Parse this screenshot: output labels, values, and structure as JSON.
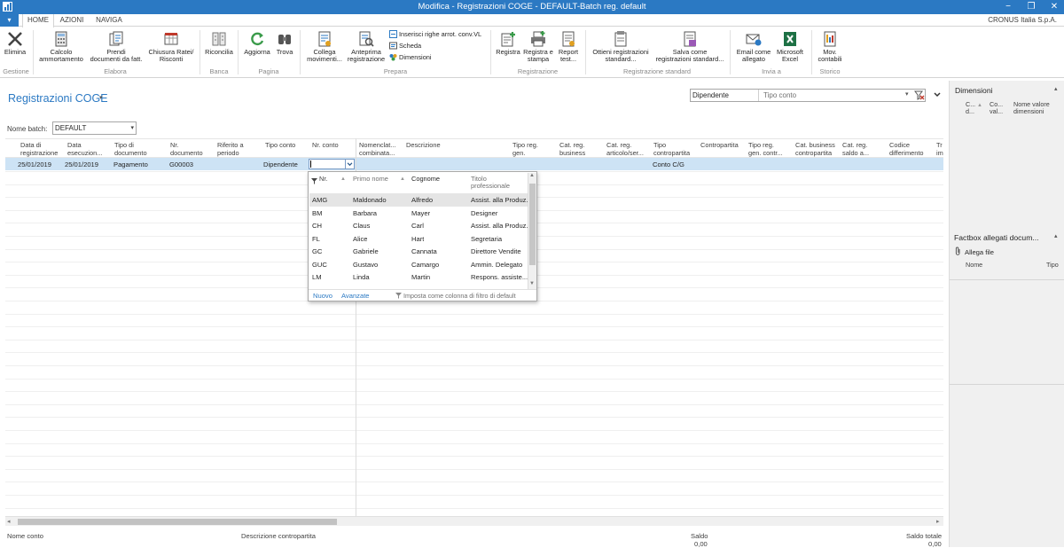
{
  "window": {
    "title": "Modifica - Registrazioni COGE - DEFAULT-Batch reg. default",
    "minimize": "−",
    "restore": "❐",
    "close": "✕",
    "colors": {
      "titlebar": "#2b79c3",
      "selection": "#cde3f5",
      "link": "#2b79c3"
    }
  },
  "ribbon": {
    "tabs": [
      "HOME",
      "AZIONI",
      "NAVIGA"
    ],
    "company": "CRONUS Italia S.p.A.",
    "groups": {
      "gestione": "Gestione",
      "elabora": "Elabora",
      "banca": "Banca",
      "pagina": "Pagina",
      "prepara": "Prepara",
      "registrazione": "Registrazione",
      "registrazione_standard": "Registrazione standard",
      "invia_a": "Invia a",
      "storico": "Storico"
    },
    "buttons": {
      "elimina": "Elimina",
      "calcolo_1": "Calcolo",
      "calcolo_2": "ammortamento",
      "prendi_1": "Prendi",
      "prendi_2": "documenti da fatt.",
      "chiusura_1": "Chiusura Ratei/",
      "chiusura_2": "Risconti",
      "riconcilia": "Riconcilia",
      "aggiorna": "Aggiorna",
      "trova": "Trova",
      "collega_1": "Collega",
      "collega_2": "movimenti...",
      "anteprima_1": "Anteprima",
      "anteprima_2": "registrazione",
      "inserisci": "Inserisci righe arrot. conv.VL",
      "scheda": "Scheda",
      "dimensioni": "Dimensioni",
      "registra": "Registra",
      "registra_stampa_1": "Registra e",
      "registra_stampa_2": "stampa",
      "report_1": "Report",
      "report_2": "test...",
      "ottieni_1": "Ottieni registrazioni",
      "ottieni_2": "standard...",
      "salva_1": "Salva come",
      "salva_2": "registrazioni standard...",
      "email_1": "Email come",
      "email_2": "allegato",
      "excel_1": "Microsoft",
      "excel_2": "Excel",
      "mov_1": "Mov.",
      "mov_2": "contabili"
    }
  },
  "page": {
    "title": "Registrazioni COGE",
    "filter": {
      "value": "Dipendente",
      "field_placeholder": "Tipo conto"
    },
    "batch_label": "Nome batch:",
    "batch_value": "DEFAULT"
  },
  "grid": {
    "headers": [
      [
        "Data di",
        "registrazione"
      ],
      [
        "Data",
        "esecuzion..."
      ],
      [
        "Tipo di",
        "documento"
      ],
      [
        "Nr.",
        "documento"
      ],
      [
        "Riferito a",
        "periodo"
      ],
      [
        "Tipo conto",
        ""
      ],
      [
        "Nr. conto",
        ""
      ],
      [
        "Nomenclat...",
        "combinata..."
      ],
      [
        "Descrizione",
        ""
      ],
      [
        "Tipo reg.",
        "gen."
      ],
      [
        "Cat. reg.",
        "business"
      ],
      [
        "Cat. reg.",
        "articolo/ser..."
      ],
      [
        "Tipo",
        "contropartita"
      ],
      [
        "Contropartita",
        ""
      ],
      [
        "Tipo reg.",
        "gen. contr..."
      ],
      [
        "Cat. business",
        "contropartita"
      ],
      [
        "Cat. reg.",
        "saldo a..."
      ],
      [
        "Codice",
        "differimento"
      ],
      [
        "Tr",
        "im"
      ]
    ],
    "row": {
      "data_registrazione": "25/01/2019",
      "data_esecuzione": "25/01/2019",
      "tipo_documento": "Pagamento",
      "nr_documento": "G00003",
      "tipo_conto": "Dipendente",
      "tipo_contropartita": "Conto C/G"
    }
  },
  "lookup": {
    "headers": {
      "nr": "Nr.",
      "primo_nome": "Primo nome",
      "cognome": "Cognome",
      "titolo_1": "Titolo",
      "titolo_2": "professionale"
    },
    "rows": [
      {
        "nr": "AMG",
        "primo": "Maldonado",
        "cognome": "Alfredo",
        "titolo": "Assist. alla Produz."
      },
      {
        "nr": "BM",
        "primo": "Barbara",
        "cognome": "Mayer",
        "titolo": "Designer"
      },
      {
        "nr": "CH",
        "primo": "Claus",
        "cognome": "Carl",
        "titolo": "Assist. alla Produz."
      },
      {
        "nr": "FL",
        "primo": "Alice",
        "cognome": "Hart",
        "titolo": "Segretaria"
      },
      {
        "nr": "GC",
        "primo": "Gabriele",
        "cognome": "Cannata",
        "titolo": "Direttore Vendite"
      },
      {
        "nr": "GUC",
        "primo": "Gustavo",
        "cognome": "Camargo",
        "titolo": "Ammin. Delegato"
      },
      {
        "nr": "LM",
        "primo": "Linda",
        "cognome": "Martin",
        "titolo": "Respons. assiste..."
      }
    ],
    "footer": {
      "nuovo": "Nuovo",
      "avanzate": "Avanzate",
      "filtro": "Imposta come colonna di filtro di default"
    }
  },
  "footer": {
    "nome_conto": "Nome conto",
    "descrizione_contropartita": "Descrizione contropartita",
    "saldo": "Saldo",
    "saldo_value": "0,00",
    "saldo_totale": "Saldo totale",
    "saldo_totale_value": "0,00"
  },
  "factbox": {
    "dimensioni_title": "Dimensioni",
    "dim_col1_a": "C...",
    "dim_col1_b": "d...",
    "dim_col2_a": "Co...",
    "dim_col2_b": "val...",
    "dim_col3_a": "Nome valore",
    "dim_col3_b": "dimensioni",
    "allegati_title": "Factbox allegati docum...",
    "allega_file": "Allega file",
    "col_nome": "Nome",
    "col_tipo": "Tipo"
  }
}
